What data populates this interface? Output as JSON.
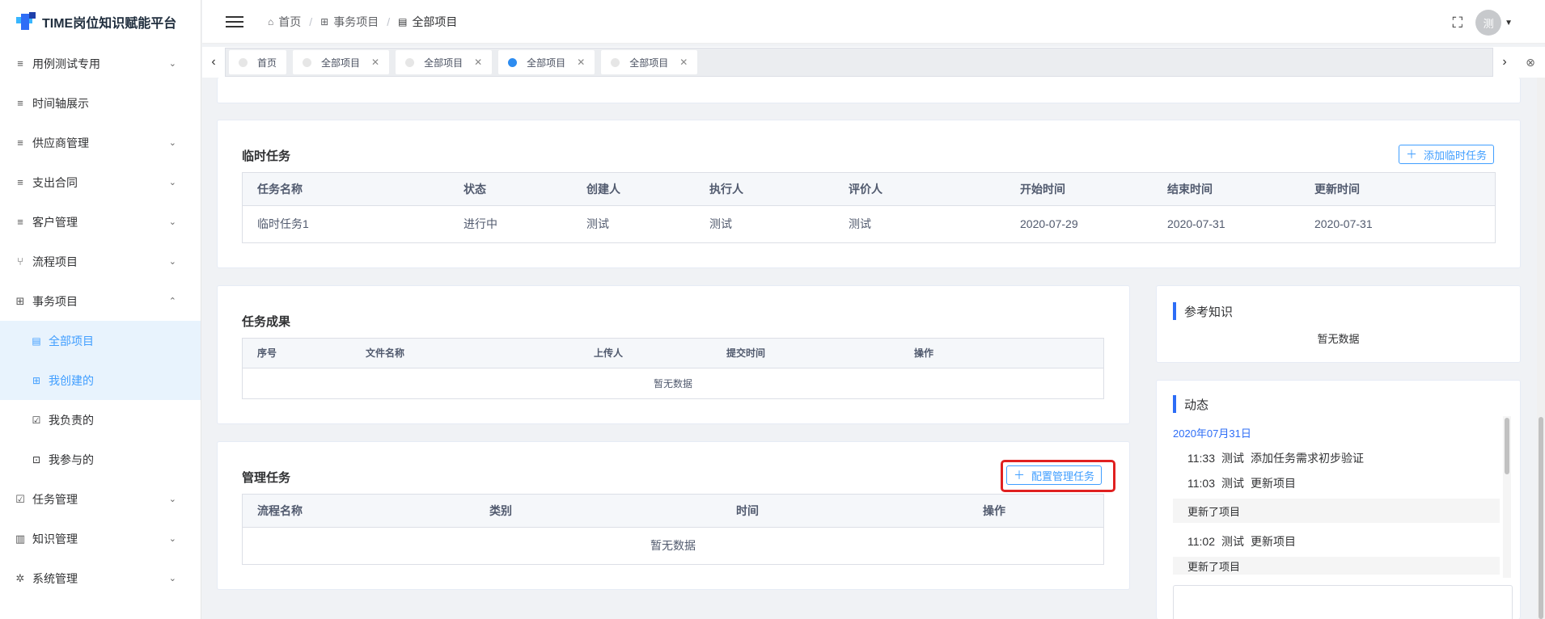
{
  "app": {
    "title": "TIME岗位知识赋能平台"
  },
  "sidebar": {
    "items": [
      {
        "label": "用例测试专用",
        "icon": "list-icon",
        "chevron": "down"
      },
      {
        "label": "时间轴展示",
        "icon": "list-icon",
        "chevron": ""
      },
      {
        "label": "供应商管理",
        "icon": "list-icon",
        "chevron": "down"
      },
      {
        "label": "支出合同",
        "icon": "list-icon",
        "chevron": "down"
      },
      {
        "label": "客户管理",
        "icon": "list-icon",
        "chevron": "down"
      },
      {
        "label": "流程项目",
        "icon": "branch-icon",
        "chevron": "down"
      },
      {
        "label": "事务项目",
        "icon": "grid-icon",
        "chevron": "up"
      }
    ],
    "subitems": [
      {
        "label": "全部项目",
        "icon": "document-icon"
      },
      {
        "label": "我创建的",
        "icon": "plus-square-icon"
      },
      {
        "label": "我负责的",
        "icon": "check-square-icon"
      },
      {
        "label": "我参与的",
        "icon": "arrow-square-icon"
      }
    ],
    "items_after": [
      {
        "label": "任务管理",
        "icon": "calendar-check-icon",
        "chevron": "down"
      },
      {
        "label": "知识管理",
        "icon": "book-icon",
        "chevron": "down"
      },
      {
        "label": "系统管理",
        "icon": "gear-icon",
        "chevron": "down"
      }
    ]
  },
  "breadcrumb": [
    "首页",
    "事务项目",
    "全部项目"
  ],
  "user": {
    "avatar_text": "测"
  },
  "tabs": [
    {
      "label": "首页",
      "closable": false
    },
    {
      "label": "全部项目",
      "closable": true
    },
    {
      "label": "全部项目",
      "closable": true
    },
    {
      "label": "全部项目",
      "closable": true
    },
    {
      "label": "全部项目",
      "closable": true
    }
  ],
  "temp_tasks": {
    "title": "临时任务",
    "add_label": "添加临时任务",
    "columns": [
      "任务名称",
      "状态",
      "创建人",
      "执行人",
      "评价人",
      "开始时间",
      "结束时间",
      "更新时间"
    ],
    "rows": [
      [
        "临时任务1",
        "进行中",
        "测试",
        "测试",
        "测试",
        "2020-07-29",
        "2020-07-31",
        "2020-07-31"
      ]
    ]
  },
  "results": {
    "title": "任务成果",
    "columns": [
      "序号",
      "文件名称",
      "上传人",
      "提交时间",
      "操作"
    ],
    "empty": "暂无数据"
  },
  "mgmt": {
    "title": "管理任务",
    "config_label": "配置管理任务",
    "columns": [
      "流程名称",
      "类别",
      "时间",
      "操作"
    ],
    "empty": "暂无数据"
  },
  "reference": {
    "title": "参考知识",
    "empty": "暂无数据"
  },
  "feed": {
    "title": "动态",
    "date": "2020年07月31日",
    "entries": [
      {
        "time": "11:33",
        "user": "测试",
        "action": "添加任务需求初步验证"
      },
      {
        "time": "11:03",
        "user": "测试",
        "action": "更新项目"
      },
      {
        "note": "更新了项目"
      },
      {
        "time": "11:02",
        "user": "测试",
        "action": "更新项目"
      },
      {
        "note": "更新了项目"
      }
    ]
  },
  "colors": {
    "accent": "#409eff",
    "highlight": "#e02020",
    "active_bg": "#e8f3fd"
  }
}
